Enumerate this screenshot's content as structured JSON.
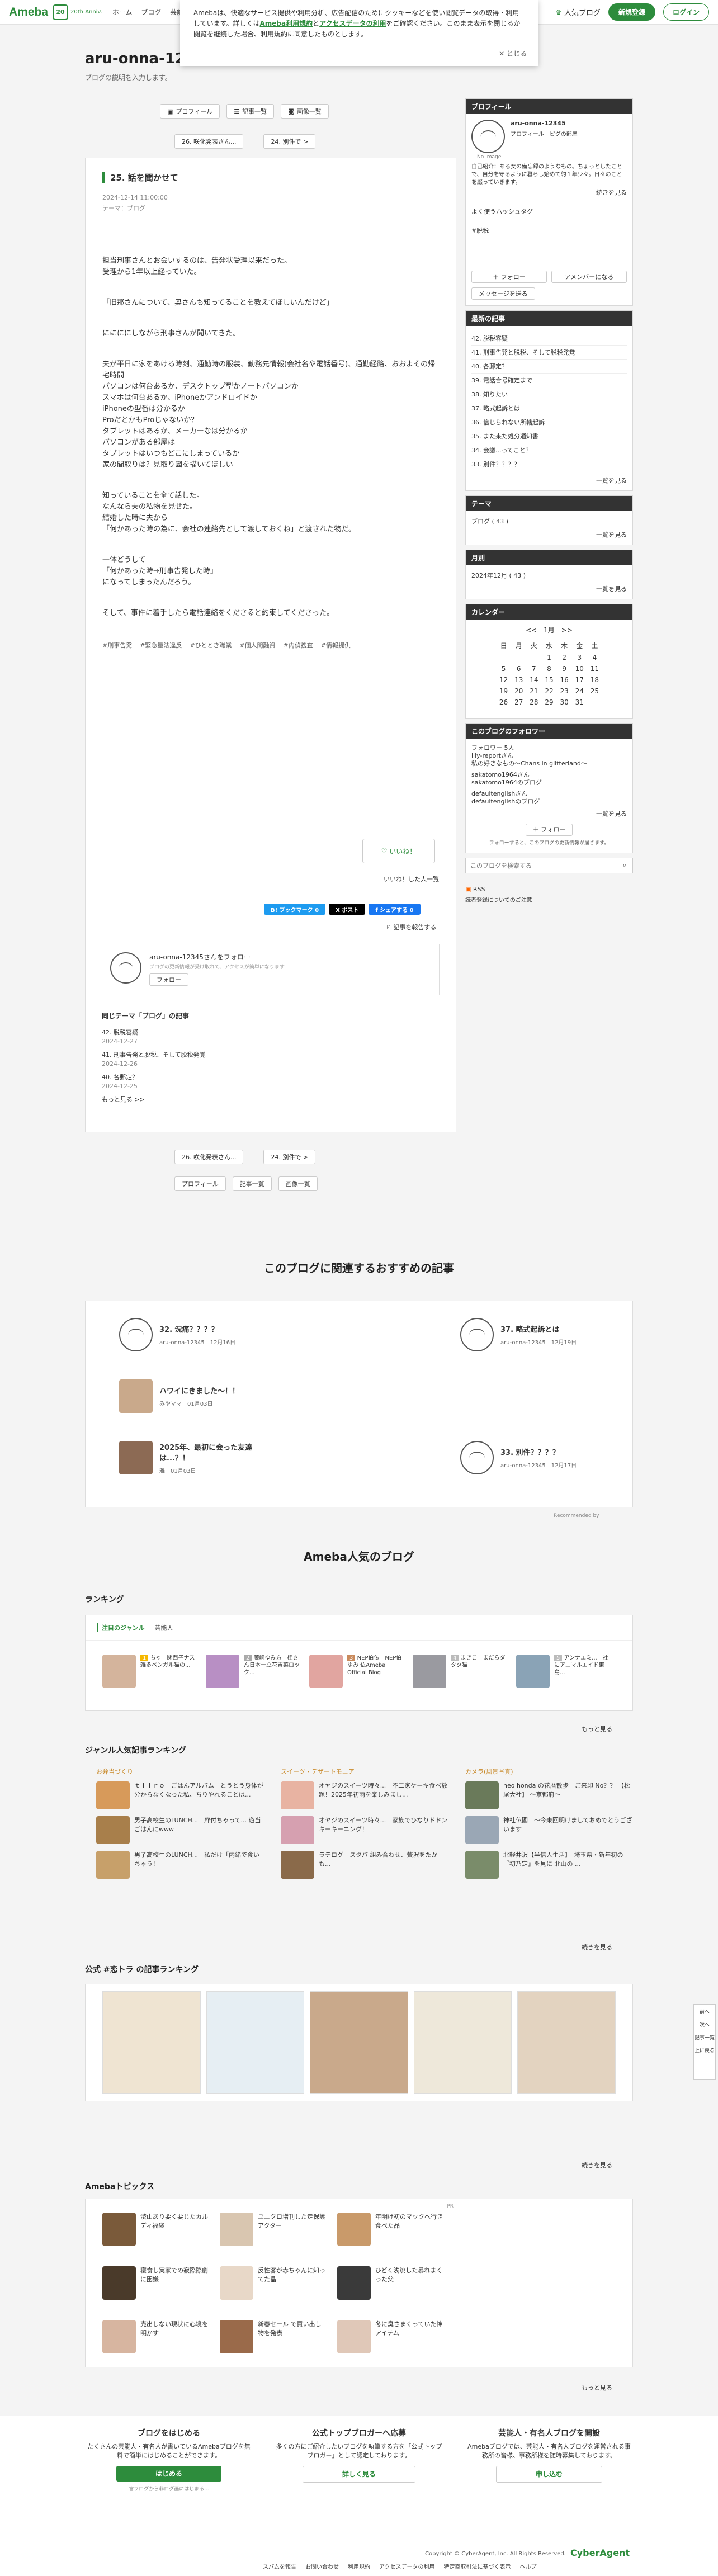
{
  "topbar": {
    "logo": "Ameba",
    "badge": "20",
    "logo_sub": "20th Anniv.",
    "nav": [
      "ホーム",
      "ブログ",
      "芸能人"
    ],
    "popular": "人気ブログ",
    "signup": "新規登録",
    "login": "ログイン"
  },
  "cookie": {
    "text1": "Amebaは、快適なサービス提供や利用分析、広告配信のためにクッキーなどを使い閲覧データの取得・利用しています。詳しくは",
    "link1": "Ameba利用規約",
    "mid": "と",
    "link2": "アクセスデータの利用",
    "text2": "をご確認ください。このまま表示を閉じるか閲覧を継続した場合、利用規約に同意したものとします。",
    "close": "とじる"
  },
  "blog": {
    "title": "aru-onna-12345",
    "desc": "ブログの説明を入力します。"
  },
  "pills": {
    "profile": "プロフィール",
    "entries": "記事一覧",
    "images": "画像一覧",
    "prev": "26. 咲化発表さん...",
    "next": "24. 別件で >"
  },
  "article": {
    "title": "25. 話を聞かせて",
    "date": "2024-12-14 11:00:00",
    "theme": "テーマ：ブログ",
    "paras": [
      "担当刑事さんとお会いするのは、告発状受理以来だった。\n受理から1年以上経っていた。",
      "「旧那さんについて、奥さんも知ってることを教えてほしいんだけど」",
      "ににににしながら刑事さんが聞いてきた。",
      "夫が平日に家をあける時刻、通勤時の服装、勤務先情報(会社名や電話番号)、通勤経路、おおよその帰宅時間\nパソコンは何台あるか、デスクトップ型かノートパソコンか\nスマホは何台あるか、iPhoneかアンドロイドか\niPhoneの型番は分かるか\nProだとかもProじゃないか？\nタブレットはあるか、メーカーなは分かるか\nパソコンがある部屋は\nタブレットはいつもどこにしまっているか\n家の間取りは？見取り図を描いてほしい",
      "知っていることを全て話した。\nなんなら夫の私物を見せた。\n結婚した時に夫から\n「何かあった時の為に、会社の連絡先として渡しておくね」と渡された物だ。",
      "一体どうして\n「何かあった時→刑事告発した時」\nになってしまったんだろう。",
      "そして、事件に着手したら電話連絡をくださると約束してくださった。"
    ],
    "tags": [
      "#刑事告発",
      "#緊急量法違反",
      "#ひととき職業",
      "#個人間融資",
      "#内偵捜査",
      "#情報提供"
    ],
    "like": "いいね！",
    "like_note": "いいね！した人一覧",
    "share": {
      "bookmark": "B! ブックマーク 0",
      "x": "X ポスト",
      "fb": "f シェアする 0"
    },
    "report": "記事を報告する",
    "follow": {
      "text": "aru-onna-12345さんをフォロー",
      "sub": "ブログの更新情報が受け取れて、アクセスが簡単になります",
      "btn": "フォロー"
    },
    "sameTheme": {
      "title": "同じテーマ「ブログ」の記事",
      "items": [
        {
          "t": "42. 脱税容疑",
          "d": "2024-12-27"
        },
        {
          "t": "41. 刑事告発と脱税、そして脱税発覚",
          "d": "2024-12-26"
        },
        {
          "t": "40. 各郵定？",
          "d": "2024-12-25"
        }
      ],
      "more": "もっと見る >>"
    }
  },
  "sidebar": {
    "profile": {
      "h": "プロフィール",
      "name": "aru-onna-12345",
      "links": "プロフィール　ピグの部屋",
      "bio": "自己紹介：ある女の備忘録のようなもの。ちょっとしたことで、自分を守るように暮らし始めて約１年少々。日々のことを綴っていきます。",
      "more": "続きを見る",
      "hashtag_title": "よく使うハッシュタグ",
      "hashtag": "#脱税",
      "follow": "＋ フォロー",
      "amember": "アメンバーになる",
      "msg": "メッセージを送る",
      "noimage": "No Image"
    },
    "recent": {
      "h": "最新の記事",
      "items": [
        "42. 脱税容疑",
        "41. 刑事告発と脱税、そして脱税発覚",
        "40. 各郵定？",
        "39. 電話合号確定まで",
        "38. 知りたい",
        "37. 略式起訴とは",
        "36. 信じられない所轄起訴",
        "35. また来た処分通知書",
        "34. 会議...ってこと？",
        "33. 別件？？？？"
      ],
      "more": "一覧を見る"
    },
    "theme": {
      "h": "テーマ",
      "item": "ブログ ( 43 )",
      "more": "一覧を見る"
    },
    "month": {
      "h": "月別",
      "item": "2024年12月 ( 43 )",
      "more": "一覧を見る"
    },
    "calendar": {
      "h": "カレンダー",
      "nav": "<<　1月　>>",
      "head": [
        "日",
        "月",
        "火",
        "水",
        "木",
        "金",
        "土"
      ],
      "rows": [
        [
          "",
          "",
          "",
          "1",
          "2",
          "3",
          "4"
        ],
        [
          "5",
          "6",
          "7",
          "8",
          "9",
          "10",
          "11"
        ],
        [
          "12",
          "13",
          "14",
          "15",
          "16",
          "17",
          "18"
        ],
        [
          "19",
          "20",
          "21",
          "22",
          "23",
          "24",
          "25"
        ],
        [
          "26",
          "27",
          "28",
          "29",
          "30",
          "31",
          ""
        ]
      ]
    },
    "followers": {
      "h": "このブログのフォロワー",
      "count": "フォロワー 5人",
      "items": [
        "lily-reportさん",
        "私の好きなもの〜Chans in glitterland〜",
        "sakatomo1964さん",
        "sakatomo1964のブログ",
        "defaultenglishさん",
        "defaultenglishのブログ"
      ],
      "more": "一覧を見る",
      "btn": "＋ フォロー",
      "note": "フォローすると、このブログの更新情報が届きます。"
    },
    "search": {
      "placeholder": "このブログを検索する"
    },
    "rss": "RSS",
    "rss_note": "読者登録についてのご注意"
  },
  "recommend": {
    "title": "このブログに関連するおすすめの記事",
    "items": [
      {
        "t": "32. 況痛？？？？",
        "s": "aru-onna-12345　12月16日"
      },
      {
        "t": "37. 略式起訴とは",
        "s": "aru-onna-12345　12月19日"
      },
      {
        "t": "ハワイにきました〜！！",
        "s": "みやママ　01月03日"
      },
      {
        "t": "2025年、最初に会った友達は...？！",
        "s": "雅　01月03日"
      },
      {
        "t": "33. 別件？？？？",
        "s": "aru-onna-12345　12月17日"
      }
    ],
    "credit": "Recommended by"
  },
  "popular": {
    "title": "Ameba人気のブログ",
    "ranking": "ランキング",
    "tabs": [
      "注目のジャンル",
      "芸能人"
    ],
    "cards": [
      {
        "n": "1",
        "t": "ちゃ　関西子ナス雑多ベンガル猫の..."
      },
      {
        "n": "2",
        "t": "藤崎ゆみ方　桂さん日本一立花吉菜ロック..."
      },
      {
        "n": "3",
        "t": "NEP伯仏　NEP伯ゆみ 仏Ameba Official Blog"
      },
      {
        "n": "4",
        "t": "まきこ　まだらダタタ猫"
      },
      {
        "n": "5",
        "t": "アンナエミ...　社にアニマルエイド東島..."
      }
    ],
    "more": "もっと見る",
    "genre_title": "ジャンル人気記事ランキング",
    "genres": [
      {
        "h": "お弁当づくり",
        "items": [
          "ｔｉｉｒｏ　ごはんアルバム　とうとう身体が分からなくなった私、ちりやれることは...",
          "男子高校生のLUNCH...　扉付ちゃって... 遊当ごはんにwww",
          "男子高校生のLUNCH...　私だけ「内緒で食いちゃう！"
        ]
      },
      {
        "h": "スイーツ・デザートモニア",
        "items": [
          "オヤジのスイーツ時々...　不二家ケーキ食べ放題！2025年初雨を楽しみまし...",
          "オヤジのスイーツ時々...　家族でひなりドドンキーキーニング！",
          "ラテログ　スタバ 組み合わせ、贅沢をたかも..."
        ]
      },
      {
        "h": "カメラ(風景写真)",
        "items": [
          "neo honda の花暦散歩　ご来印 No？？ 【松尾大社】 ～京都府～",
          "神社仏閣　〜今未回明けましておめでとうございます",
          "北軽井沢【半信人生活】　埼玉県・新年初の『初乃定』を見に 北山の ..."
        ]
      }
    ],
    "genre_more": "続きを見る",
    "official_title": "公式 #恋トラ の記事ランキング",
    "more2": "続きを見る"
  },
  "topics": {
    "title": "Amebaトピックス",
    "pr": "PR",
    "items": [
      "渋山あり要く要じたカルディ福袋",
      "ユニクロ増刊した走保護アクター",
      "年明け初のマックへ行き食べた品",
      "寝食し実家での寂際際劇に困嫌",
      "反性客が赤ちゃんに知ってた晶",
      "ひどく浅眺した暴れまくった父",
      "売出しない現状に心境を明かす",
      "新春セール で買い出し物を発表",
      "冬に臭さまくっていた神アイテム"
    ],
    "more": "もっと見る"
  },
  "footer": {
    "cols": [
      {
        "h": "ブログをはじめる",
        "t": "たくさんの芸能人・有名人が書いているAmebaブログを無料で簡単にはじめることができます。",
        "btn": "はじめる",
        "sub": "官フログから非ログ画にはじまる..."
      },
      {
        "h": "公式トップブロガーへ応募",
        "t": "多くの方にご紹介したいブログを執筆する方を「公式トップブロガー」として認定しております。",
        "btn": "詳しく見る"
      },
      {
        "h": "芸能人・有名人ブログを開設",
        "t": "Amebaブログでは、芸能人・有名人ブログを運営される事務所の皆様、事務所様を随時募集しております。",
        "btn": "申し込む"
      }
    ],
    "copyright": "Copyright © CyberAgent, Inc. All Rights Reserved.",
    "ca": "CyberAgent",
    "links": [
      "スパムを報告",
      "お問い合わせ",
      "利用規約",
      "アクセスデータの利用",
      "特定商取引法に基づく表示",
      "ヘルプ"
    ]
  },
  "sidefixed": {
    "prev": "前へ",
    "next": "次へ",
    "list": "記事一覧",
    "top": "上に戻る"
  }
}
